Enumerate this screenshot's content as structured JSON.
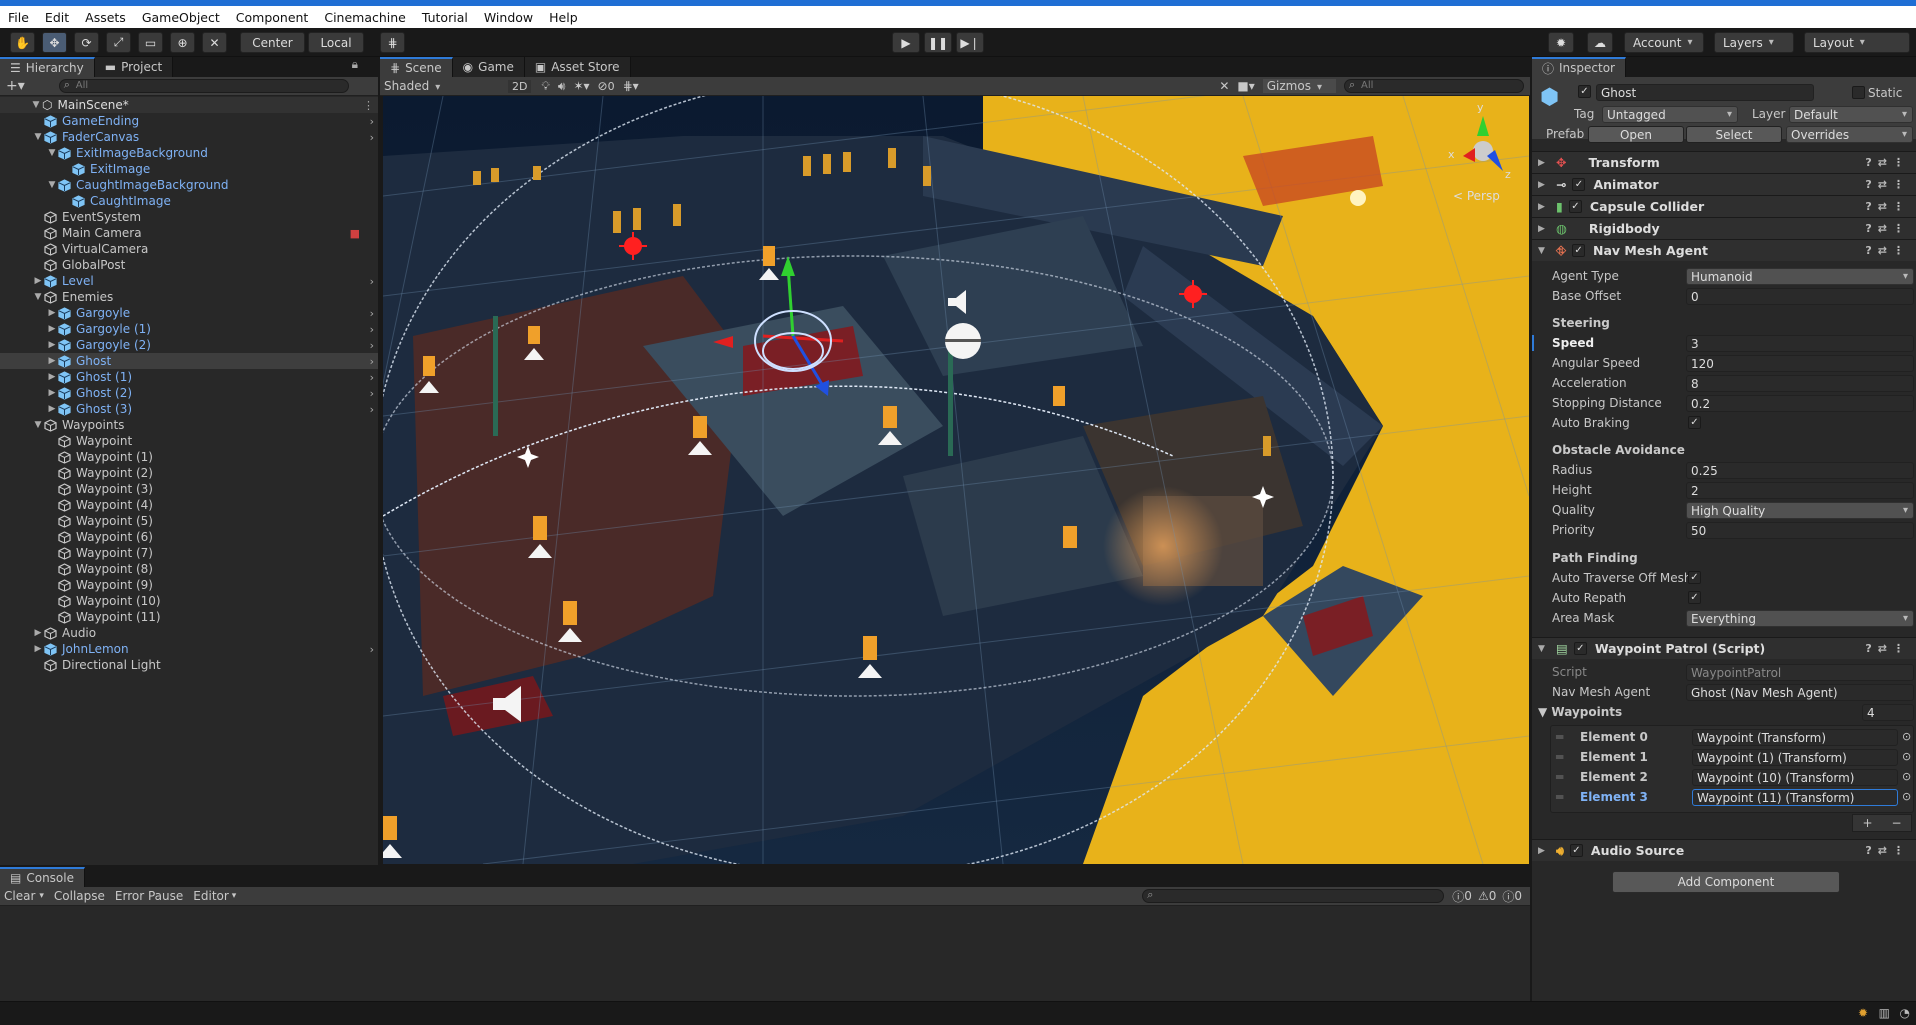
{
  "menu": [
    "File",
    "Edit",
    "Assets",
    "GameObject",
    "Component",
    "Cinemachine",
    "Tutorial",
    "Window",
    "Help"
  ],
  "toolbar": {
    "pivot": "Center",
    "space": "Local",
    "account": "Account",
    "layers": "Layers",
    "layout": "Layout"
  },
  "hierarchy": {
    "tab": "Hierarchy",
    "project_tab": "Project",
    "search_placeholder": "All",
    "scene": "MainScene*",
    "items": [
      {
        "label": "GameEnding",
        "depth": 1,
        "prefab": true,
        "chev": true
      },
      {
        "label": "FaderCanvas",
        "depth": 1,
        "prefab": true,
        "expanded": true,
        "chev": true
      },
      {
        "label": "ExitImageBackground",
        "depth": 2,
        "prefab": true,
        "expanded": true
      },
      {
        "label": "ExitImage",
        "depth": 3,
        "prefab": true
      },
      {
        "label": "CaughtImageBackground",
        "depth": 2,
        "prefab": true,
        "expanded": true
      },
      {
        "label": "CaughtImage",
        "depth": 3,
        "prefab": true
      },
      {
        "label": "EventSystem",
        "depth": 1
      },
      {
        "label": "Main Camera",
        "depth": 1,
        "cam": true
      },
      {
        "label": "VirtualCamera",
        "depth": 1
      },
      {
        "label": "GlobalPost",
        "depth": 1
      },
      {
        "label": "Level",
        "depth": 1,
        "prefab": true,
        "collapsed": true,
        "chev": true
      },
      {
        "label": "Enemies",
        "depth": 1,
        "expanded": true
      },
      {
        "label": "Gargoyle",
        "depth": 2,
        "prefab": true,
        "collapsed": true,
        "chev": true
      },
      {
        "label": "Gargoyle (1)",
        "depth": 2,
        "prefab": true,
        "collapsed": true,
        "chev": true
      },
      {
        "label": "Gargoyle (2)",
        "depth": 2,
        "prefab": true,
        "collapsed": true,
        "chev": true
      },
      {
        "label": "Ghost",
        "depth": 2,
        "prefab": true,
        "collapsed": true,
        "chev": true,
        "selected": true
      },
      {
        "label": "Ghost (1)",
        "depth": 2,
        "prefab": true,
        "collapsed": true,
        "chev": true
      },
      {
        "label": "Ghost (2)",
        "depth": 2,
        "prefab": true,
        "collapsed": true,
        "chev": true
      },
      {
        "label": "Ghost (3)",
        "depth": 2,
        "prefab": true,
        "collapsed": true,
        "chev": true
      },
      {
        "label": "Waypoints",
        "depth": 1,
        "expanded": true
      },
      {
        "label": "Waypoint",
        "depth": 2
      },
      {
        "label": "Waypoint (1)",
        "depth": 2
      },
      {
        "label": "Waypoint (2)",
        "depth": 2
      },
      {
        "label": "Waypoint (3)",
        "depth": 2
      },
      {
        "label": "Waypoint (4)",
        "depth": 2
      },
      {
        "label": "Waypoint (5)",
        "depth": 2
      },
      {
        "label": "Waypoint (6)",
        "depth": 2
      },
      {
        "label": "Waypoint (7)",
        "depth": 2
      },
      {
        "label": "Waypoint (8)",
        "depth": 2
      },
      {
        "label": "Waypoint (9)",
        "depth": 2
      },
      {
        "label": "Waypoint (10)",
        "depth": 2
      },
      {
        "label": "Waypoint (11)",
        "depth": 2
      },
      {
        "label": "Audio",
        "depth": 1,
        "collapsed": true
      },
      {
        "label": "JohnLemon",
        "depth": 1,
        "prefab": true,
        "collapsed": true,
        "chev": true
      },
      {
        "label": "Directional Light",
        "depth": 1
      }
    ]
  },
  "scene_view": {
    "tabs": [
      "Scene",
      "Game",
      "Asset Store"
    ],
    "shading": "Shaded",
    "mode_2d": "2D",
    "hidden_count": "0",
    "gizmos": "Gizmos",
    "search_placeholder": "All",
    "persp": "< Persp",
    "axis_y": "y",
    "axis_x": "x",
    "axis_z": "z"
  },
  "inspector": {
    "tab": "Inspector",
    "object_name": "Ghost",
    "static_label": "Static",
    "tag_label": "Tag",
    "tag_value": "Untagged",
    "layer_label": "Layer",
    "layer_value": "Default",
    "prefab_label": "Prefab",
    "open": "Open",
    "select": "Select",
    "overrides": "Overrides",
    "components": {
      "transform": "Transform",
      "animator": "Animator",
      "capsule": "Capsule Collider",
      "rigidbody": "Rigidbody",
      "navmesh": "Nav Mesh Agent",
      "patrol": "Waypoint Patrol (Script)",
      "audio": "Audio Source"
    },
    "nav": {
      "agent_type_label": "Agent Type",
      "agent_type": "Humanoid",
      "base_offset_label": "Base Offset",
      "base_offset": "0",
      "steering": "Steering",
      "speed_label": "Speed",
      "speed": "3",
      "angular_label": "Angular Speed",
      "angular": "120",
      "accel_label": "Acceleration",
      "accel": "8",
      "stopping_label": "Stopping Distance",
      "stopping": "0.2",
      "braking_label": "Auto Braking",
      "obstacle": "Obstacle Avoidance",
      "radius_label": "Radius",
      "radius": "0.25",
      "height_label": "Height",
      "height": "2",
      "quality_label": "Quality",
      "quality": "High Quality",
      "priority_label": "Priority",
      "priority": "50",
      "pathfinding": "Path Finding",
      "traverse_label": "Auto Traverse Off Mesh",
      "repath_label": "Auto Repath",
      "area_label": "Area Mask",
      "area": "Everything"
    },
    "patrol": {
      "script_label": "Script",
      "script": "WaypointPatrol",
      "agent_label": "Nav Mesh Agent",
      "agent": "Ghost (Nav Mesh Agent)",
      "waypoints_label": "Waypoints",
      "count": "4",
      "elements": [
        {
          "label": "Element 0",
          "value": "Waypoint (Transform)"
        },
        {
          "label": "Element 1",
          "value": "Waypoint (1) (Transform)"
        },
        {
          "label": "Element 2",
          "value": "Waypoint (10) (Transform)"
        },
        {
          "label": "Element 3",
          "value": "Waypoint (11) (Transform)"
        }
      ],
      "plus": "+",
      "minus": "−"
    },
    "add_component": "Add Component"
  },
  "console": {
    "tab": "Console",
    "clear": "Clear",
    "collapse": "Collapse",
    "error_pause": "Error Pause",
    "editor": "Editor",
    "info_count": "0",
    "warn_count": "0",
    "error_count": "0"
  },
  "colors": {
    "accent": "#2f7bd8",
    "prefab_text": "#7fb2f5",
    "floor_yellow": "#e8b21a"
  }
}
